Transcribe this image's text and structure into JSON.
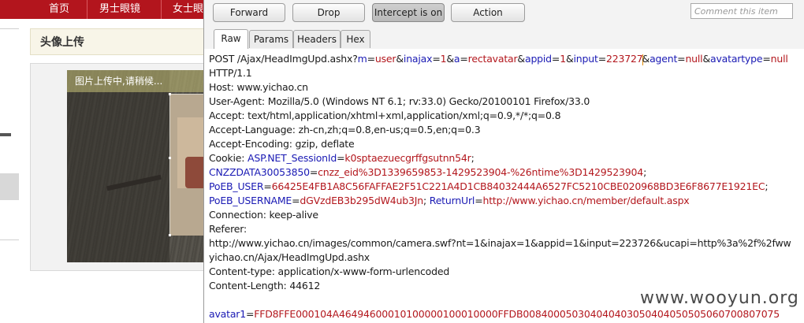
{
  "site": {
    "nav": [
      "首页",
      "男士眼镜",
      "女士眼"
    ],
    "upload_title": "头像上传",
    "upload_message": "图片上传中,请稍候..."
  },
  "burp": {
    "toolbar": {
      "forward": "Forward",
      "drop": "Drop",
      "intercept": "Intercept is on",
      "action": "Action",
      "comment_placeholder": "Comment this item"
    },
    "tabs": [
      "Raw",
      "Params",
      "Headers",
      "Hex"
    ],
    "active_tab": "Raw",
    "request": {
      "line1": {
        "method_path": "POST /Ajax/HeadImgUpd.ashx?",
        "params": [
          {
            "k": "m",
            "v": "user"
          },
          {
            "k": "inajax",
            "v": "1"
          },
          {
            "k": "a",
            "v": "rectavatar"
          },
          {
            "k": "appid",
            "v": "1"
          },
          {
            "k": "input",
            "v": "223727"
          },
          {
            "k": "agent",
            "v": "null"
          },
          {
            "k": "avatartype",
            "v": "null"
          }
        ]
      },
      "http_version": "HTTP/1.1",
      "host": "Host: www.yichao.cn",
      "user_agent": "User-Agent: Mozilla/5.0 (Windows NT 6.1; rv:33.0) Gecko/20100101 Firefox/33.0",
      "accept": "Accept: text/html,application/xhtml+xml,application/xml;q=0.9,*/*;q=0.8",
      "accept_language": "Accept-Language: zh-cn,zh;q=0.8,en-us;q=0.5,en;q=0.3",
      "accept_encoding": "Accept-Encoding: gzip, deflate",
      "cookie_prefix": "Cookie: ",
      "cookies": [
        {
          "k": "ASP.NET_SessionId",
          "v": "k0sptaezuecgrffgsutnn54r",
          "trail": ";"
        },
        {
          "k": "CNZZDATA30053850",
          "v": "cnzz_eid%3D1339659853-1429523904-%26ntime%3D1429523904",
          "trail": ";"
        },
        {
          "k": "PoEB_USER",
          "v": "66425E4FB1A8C56FAFFAE2F51C221A4D1CB84032444A6527FC5210CBE020968BD3E6F8677E1921EC",
          "trail": ";"
        },
        {
          "k": "PoEB_USERNAME",
          "v": "dGVzdEB3b295dW4ub3Jn",
          "trail": "; "
        },
        {
          "k": "ReturnUrl",
          "v": "http://www.yichao.cn/member/default.aspx",
          "trail": ""
        }
      ],
      "connection": "Connection: keep-alive",
      "referer_label": "Referer:",
      "referer_url": "http://www.yichao.cn/images/common/camera.swf?nt=1&inajax=1&appid=1&input=223726&ucapi=http%3a%2f%2fww",
      "referer_wrap": "yichao.cn/Ajax/HeadImgUpd.ashx",
      "content_type": "Content-type: application/x-www-form-urlencoded",
      "content_length": "Content-Length: 44612",
      "body_key": "avatar1",
      "body_value": "FFD8FFE000104A46494600010100000100010000FFDB008400050304040403050404050505060700807075"
    }
  },
  "watermark": "www.wooyun.org",
  "colors": {
    "nav_red": "#b3151d",
    "param_key_blue": "#1a1ab4",
    "param_value_red": "#b3171d"
  }
}
